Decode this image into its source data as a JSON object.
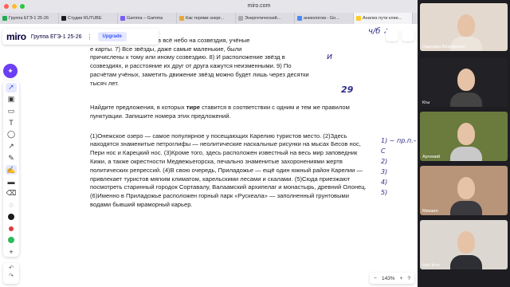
{
  "browser": {
    "url": "miro.com",
    "tabs": [
      {
        "label": "Группа ЕГЭ-1 25-26",
        "color": "#22aa55"
      },
      {
        "label": "Студия RUTUBE",
        "color": "#1b1b1f"
      },
      {
        "label": "Gamma – Gamma",
        "color": "#7b5cf5"
      },
      {
        "label": "Как терями энерг...",
        "color": "#e5a83b"
      },
      {
        "label": "Энергетический...",
        "color": "#aaaaaa"
      },
      {
        "label": "анмологом - Go...",
        "color": "#4a8af4"
      },
      {
        "label": "Анализ пути клие...",
        "color": "#ffcc22",
        "active": true
      }
    ]
  },
  "miro": {
    "logo": "miro",
    "board_name": "Группа ЕГЭ-1 25-26",
    "upgrade_label": "Upgrade",
    "zoom": "143%",
    "help": "?"
  },
  "document": {
    "partial_line1": "ные фигуры. 6) Разделив всё небо на созвездия, учёные",
    "partial_line2": "е карты. 7) Все звёзды, даже самые маленькие, были",
    "partial_line3": "причислены к тому или иному созвездию. 8) И расположение звёзд в",
    "partial_line4": "созвездиях, и расстояние их друг от друга кажутся неизменными. 9) По",
    "partial_line5": "расчётам учёных, заметить движение звёзд можно будет лишь через десятки",
    "partial_line6": "тысяч лет.",
    "task_before": "Найдите предложения, в которых ",
    "task_bold": "тире",
    "task_after": " ставится в соответствии с одним и тем же правилом пунктуации. Запишите номера этих предложений.",
    "example": "(1)Онежское озеро — самое популярное у посещающих Карелию туристов место. (2)Здесь находятся знаменитые петроглифы — неолитические наскальные рисунки на мысах Бесов нос, Пери нос и Карецкий нос. (3)Кроме того, здесь расположен известный на весь мир заповедник Кижи, а также окрестности Медвежьегорска, печально знаменитые захоронениями жертв политических репрессий. (4)В свою очередь, Приладожье — ещё один южный район Карелии — привлекает туристов мягким климатом, карельскими лесами и скалами. (5)Сюда приезжают посмотреть старинный городок Сортавалу, Валаамский архипелаг и монастырь, древний Олонец. (6)Именно в Приладожье расположен горный парк «Рускеала» — заполненный грунтовыми водами бывший мраморный карьер."
  },
  "annotations": {
    "top_scribble": "ч/б ↗",
    "margin_mark": "и",
    "num_mark": "29",
    "list": [
      "1) ~ пр.п.–С",
      "2)",
      "3)",
      "4)",
      "5)"
    ]
  },
  "participants": [
    {
      "name": "Надежда Вешовская",
      "bg": "#e4d9cf",
      "shirt": "#ece5dc"
    },
    {
      "name": "Кгы",
      "bg": "#222226",
      "shirt": "#444"
    },
    {
      "name": "Артемий",
      "bg": "#6b7a3d",
      "shirt": "#c9c9c9"
    },
    {
      "name": "Михаил",
      "bg": "#b89479",
      "shirt": "#3a3a3f"
    },
    {
      "name": "Iryki tirvv",
      "bg": "#dcd7d0",
      "shirt": "#2d2f34"
    }
  ]
}
